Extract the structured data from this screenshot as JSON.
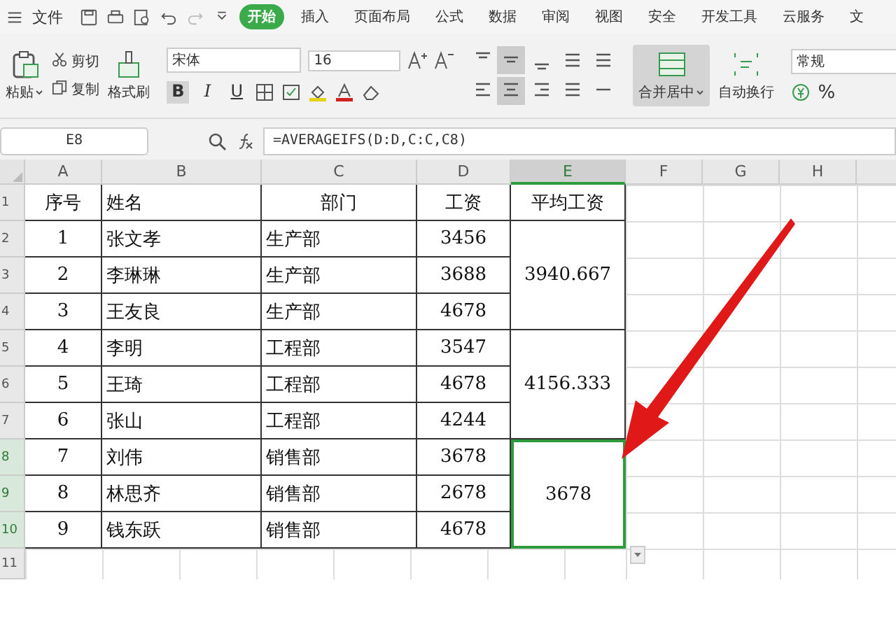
{
  "menu": {
    "file": "文件",
    "tabs": [
      {
        "label": "开始",
        "selected": true
      },
      {
        "label": "插入",
        "selected": false
      },
      {
        "label": "页面布局",
        "selected": false
      },
      {
        "label": "公式",
        "selected": false
      },
      {
        "label": "数据",
        "selected": false
      },
      {
        "label": "审阅",
        "selected": false
      },
      {
        "label": "视图",
        "selected": false
      },
      {
        "label": "安全",
        "selected": false
      },
      {
        "label": "开发工具",
        "selected": false
      },
      {
        "label": "云服务",
        "selected": false
      },
      {
        "label": "文",
        "selected": false
      }
    ]
  },
  "ribbon": {
    "paste": "粘贴",
    "cut": "剪切",
    "copy": "复制",
    "format_painter": "格式刷",
    "font": "宋体",
    "font_size": "16",
    "bold": "B",
    "italic": "I",
    "underline": "U",
    "merge": "合并居中",
    "wrap": "自动换行",
    "number_format": "常规",
    "percent": "%"
  },
  "name_box": "E8",
  "formula": "=AVERAGEIFS(D:D,C:C,C8)",
  "columns": [
    {
      "label": "A",
      "selected": false
    },
    {
      "label": "B",
      "selected": false
    },
    {
      "label": "C",
      "selected": false
    },
    {
      "label": "D",
      "selected": false
    },
    {
      "label": "E",
      "selected": true
    },
    {
      "label": "F",
      "selected": false
    },
    {
      "label": "G",
      "selected": false
    },
    {
      "label": "H",
      "selected": false
    }
  ],
  "row_numbers": [
    {
      "label": "1",
      "selected": false
    },
    {
      "label": "2",
      "selected": false
    },
    {
      "label": "3",
      "selected": false
    },
    {
      "label": "4",
      "selected": false
    },
    {
      "label": "5",
      "selected": false
    },
    {
      "label": "6",
      "selected": false
    },
    {
      "label": "7",
      "selected": false
    },
    {
      "label": "8",
      "selected": true
    },
    {
      "label": "9",
      "selected": true
    },
    {
      "label": "10",
      "selected": true
    },
    {
      "label": "11",
      "selected": false
    }
  ],
  "header": [
    "序号",
    "姓名",
    "部门",
    "工资",
    "平均工资"
  ],
  "rows": [
    [
      "1",
      "张文孝",
      "生产部",
      "3456"
    ],
    [
      "2",
      "李琳琳",
      "生产部",
      "3688"
    ],
    [
      "3",
      "王友良",
      "生产部",
      "4678"
    ],
    [
      "4",
      "李明",
      "工程部",
      "3547"
    ],
    [
      "5",
      "王琦",
      "工程部",
      "4678"
    ],
    [
      "6",
      "张山",
      "工程部",
      "4244"
    ],
    [
      "7",
      "刘伟",
      "销售部",
      "3678"
    ],
    [
      "8",
      "林思齐",
      "销售部",
      "2678"
    ],
    [
      "9",
      "钱东跃",
      "销售部",
      "4678"
    ]
  ],
  "averages": [
    {
      "value": "3940.667",
      "selected": false
    },
    {
      "value": "4156.333",
      "selected": false
    },
    {
      "value": "3678",
      "selected": true
    }
  ]
}
